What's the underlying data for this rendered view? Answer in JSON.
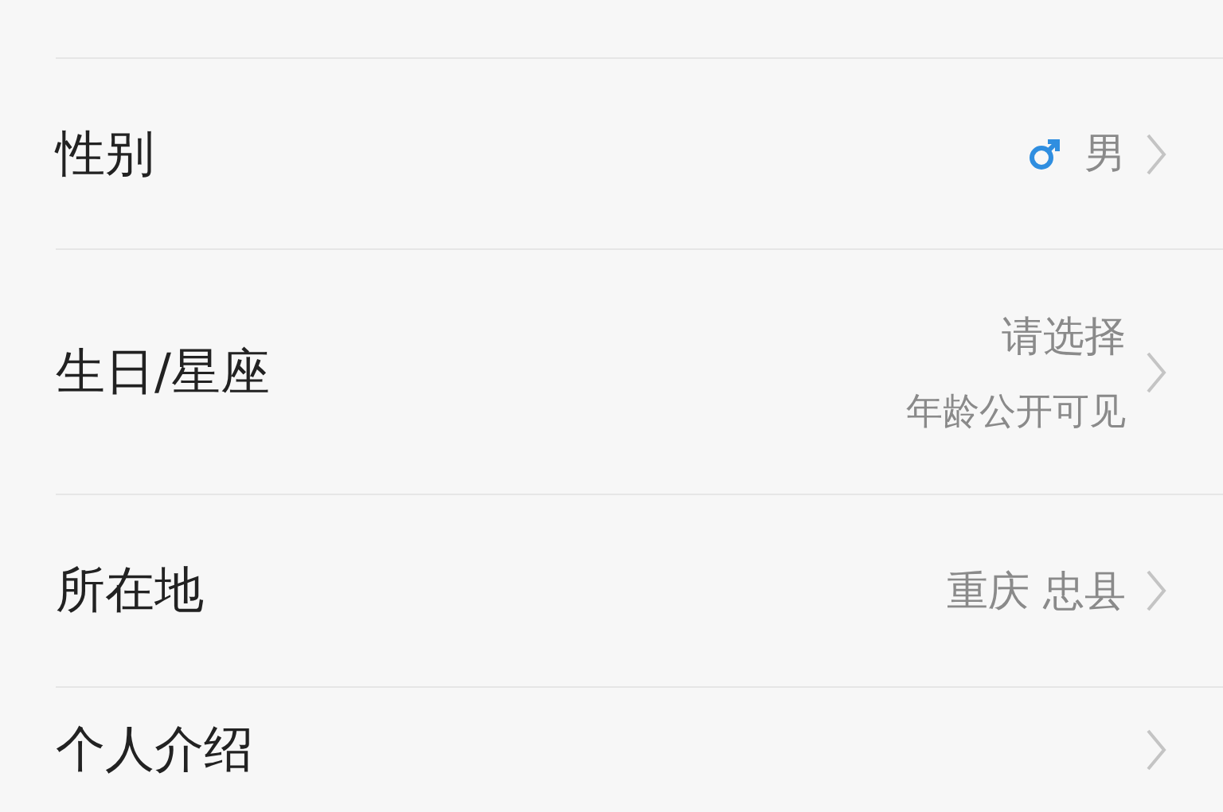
{
  "rows": [
    {
      "kind": "gender",
      "label": "性别",
      "values": [
        "男"
      ]
    },
    {
      "kind": "plain",
      "label": "生日/星座",
      "values": [
        "请选择",
        "年龄公开可见"
      ]
    },
    {
      "kind": "plain",
      "label": "所在地",
      "values": [
        "重庆 忠县"
      ]
    },
    {
      "kind": "plain",
      "label": "个人介绍",
      "values": []
    }
  ]
}
